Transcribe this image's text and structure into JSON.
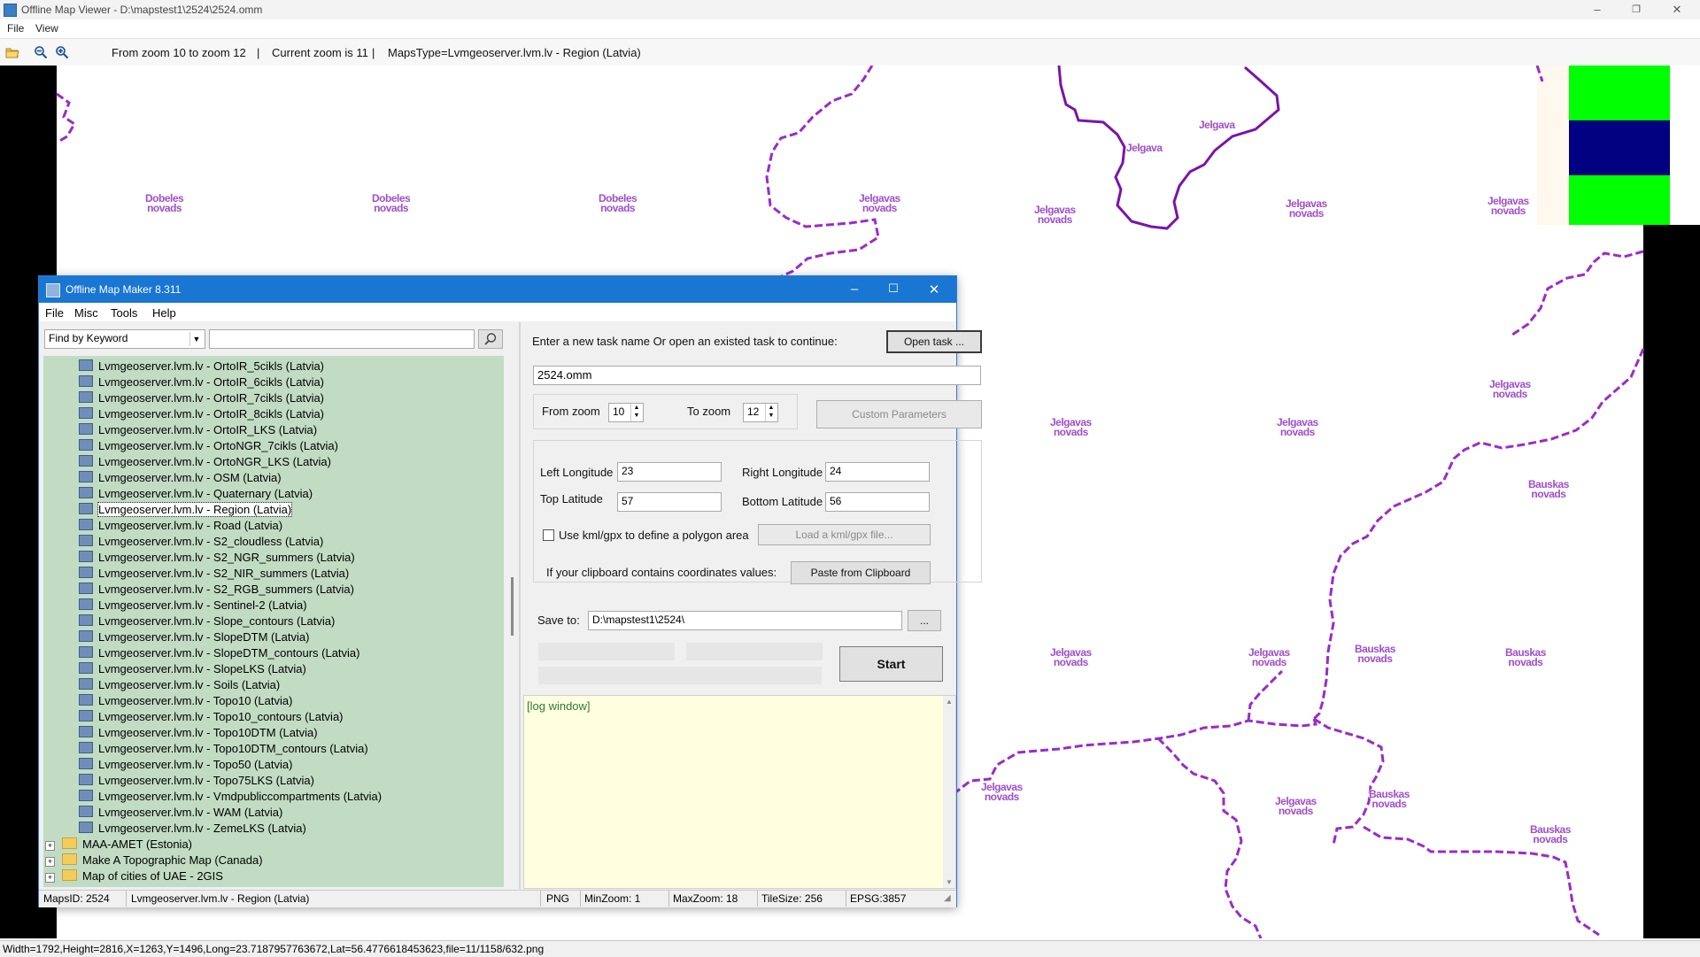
{
  "window": {
    "title": "Offline Map Viewer - D:\\mapstest1\\2524\\2524.omm"
  },
  "menu": {
    "file": "File",
    "view": "View"
  },
  "toolbar": {
    "zoom_range": "From zoom 10 to zoom 12",
    "sep1": "|",
    "current_zoom": "Current zoom is 11",
    "sep2": "|",
    "maps_type": "MapsType=Lvmgeoserver.lvm.lv - Region (Latvia)"
  },
  "map": {
    "labels": {
      "dobeles": "Dobeles novads",
      "jelgavas": "Jelgavas novads",
      "bauskas": "Bauskas novads",
      "jelgava": "Jelgava"
    },
    "colors": {
      "border": "#9b2bc8",
      "city": "#7a14a8",
      "green": "#00ff00",
      "navy": "#000080"
    }
  },
  "status": {
    "text": "Width=1792,Height=2816,X=1263,Y=1496,Long=23.7187957763672,Lat=56.4776618453623,file=11/1158/632.png"
  },
  "dialog": {
    "title": "Offline Map Maker 8.311",
    "menu": {
      "file": "File",
      "misc": "Misc",
      "tools": "Tools",
      "help": "Help"
    },
    "search": {
      "mode": "Find by Keyword",
      "value": ""
    },
    "tree": {
      "items": [
        "Lvmgeoserver.lvm.lv - OrtoIR_5cikls (Latvia)",
        "Lvmgeoserver.lvm.lv - OrtoIR_6cikls (Latvia)",
        "Lvmgeoserver.lvm.lv - OrtoIR_7cikls (Latvia)",
        "Lvmgeoserver.lvm.lv - OrtoIR_8cikls (Latvia)",
        "Lvmgeoserver.lvm.lv - OrtoIR_LKS (Latvia)",
        "Lvmgeoserver.lvm.lv - OrtoNGR_7cikls (Latvia)",
        "Lvmgeoserver.lvm.lv - OrtoNGR_LKS (Latvia)",
        "Lvmgeoserver.lvm.lv - OSM (Latvia)",
        "Lvmgeoserver.lvm.lv - Quaternary (Latvia)",
        "Lvmgeoserver.lvm.lv - Region (Latvia)",
        "Lvmgeoserver.lvm.lv - Road (Latvia)",
        "Lvmgeoserver.lvm.lv - S2_cloudless (Latvia)",
        "Lvmgeoserver.lvm.lv - S2_NGR_summers (Latvia)",
        "Lvmgeoserver.lvm.lv - S2_NIR_summers (Latvia)",
        "Lvmgeoserver.lvm.lv - S2_RGB_summers (Latvia)",
        "Lvmgeoserver.lvm.lv - Sentinel-2 (Latvia)",
        "Lvmgeoserver.lvm.lv - Slope_contours (Latvia)",
        "Lvmgeoserver.lvm.lv - SlopeDTM (Latvia)",
        "Lvmgeoserver.lvm.lv - SlopeDTM_contours (Latvia)",
        "Lvmgeoserver.lvm.lv - SlopeLKS (Latvia)",
        "Lvmgeoserver.lvm.lv - Soils (Latvia)",
        "Lvmgeoserver.lvm.lv - Topo10 (Latvia)",
        "Lvmgeoserver.lvm.lv - Topo10_contours (Latvia)",
        "Lvmgeoserver.lvm.lv - Topo10DTM (Latvia)",
        "Lvmgeoserver.lvm.lv - Topo10DTM_contours (Latvia)",
        "Lvmgeoserver.lvm.lv - Topo50 (Latvia)",
        "Lvmgeoserver.lvm.lv - Topo75LKS (Latvia)",
        "Lvmgeoserver.lvm.lv - Vmdpubliccompartments (Latvia)",
        "Lvmgeoserver.lvm.lv - WAM (Latvia)",
        "Lvmgeoserver.lvm.lv - ZemeLKS (Latvia)"
      ],
      "selected_index": 9,
      "groups": [
        "MAA-AMET (Estonia)",
        "Make A Topographic Map (Canada)",
        "Map of cities of UAE - 2GIS"
      ]
    },
    "task_prompt": "Enter a new task name Or open an existed task to continue:",
    "open_task": "Open task ...",
    "task_name": "2524.omm",
    "from_zoom_label": "From zoom",
    "from_zoom": "10",
    "to_zoom_label": "To zoom",
    "to_zoom": "12",
    "custom_params": "Custom Parameters",
    "left_lon_label": "Left Longitude",
    "left_lon": "23",
    "right_lon_label": "Right Longitude",
    "right_lon": "24",
    "top_lat_label": "Top Latitude",
    "top_lat": "57",
    "bottom_lat_label": "Bottom Latitude",
    "bottom_lat": "56",
    "kml_label": "Use kml/gpx to define a polygon area",
    "kml_button": "Load a kml/gpx file...",
    "clipboard_label": "If your clipboard contains coordinates values:",
    "clipboard_button": "Paste from Clipboard",
    "save_label": "Save to:",
    "save_path": "D:\\mapstest1\\2524\\",
    "browse": "...",
    "start": "Start",
    "log_title": "[log window]",
    "status": {
      "maps_id": "MapsID: 2524",
      "map_name": "Lvmgeoserver.lvm.lv - Region (Latvia)",
      "format": "PNG",
      "min_zoom": "MinZoom: 1",
      "max_zoom": "MaxZoom: 18",
      "tile_size": "TileSize: 256",
      "epsg": "EPSG:3857"
    }
  }
}
